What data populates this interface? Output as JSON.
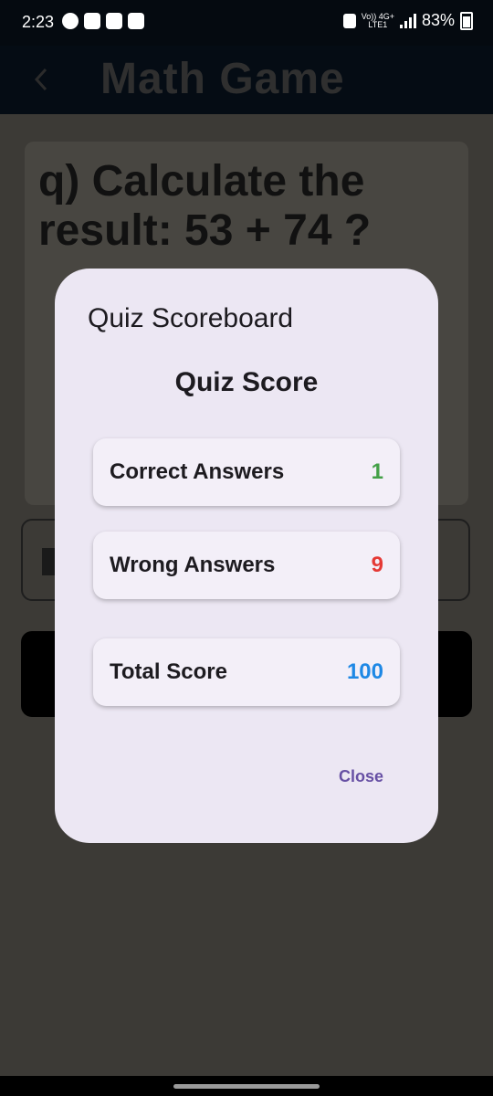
{
  "status_bar": {
    "time": "2:23",
    "network_top": "Vo)) 4G+",
    "network_bottom": "LTE1",
    "battery": "83%"
  },
  "app_bar": {
    "title": "Math Game",
    "back_icon": "chevron-left-icon"
  },
  "question": {
    "text": "q) Calculate the result: 53 + 74 ?"
  },
  "dialog": {
    "title": "Quiz Scoreboard",
    "heading": "Quiz Score",
    "rows": [
      {
        "label": "Correct Answers",
        "value": "1",
        "color": "#43a047"
      },
      {
        "label": "Wrong Answers",
        "value": "9",
        "color": "#e53935"
      },
      {
        "label": "Total Score",
        "value": "100",
        "color": "#1e88e5"
      }
    ],
    "close_label": "Close"
  },
  "colors": {
    "accent": "#6750a4",
    "dialog_bg": "#ece7f3"
  }
}
